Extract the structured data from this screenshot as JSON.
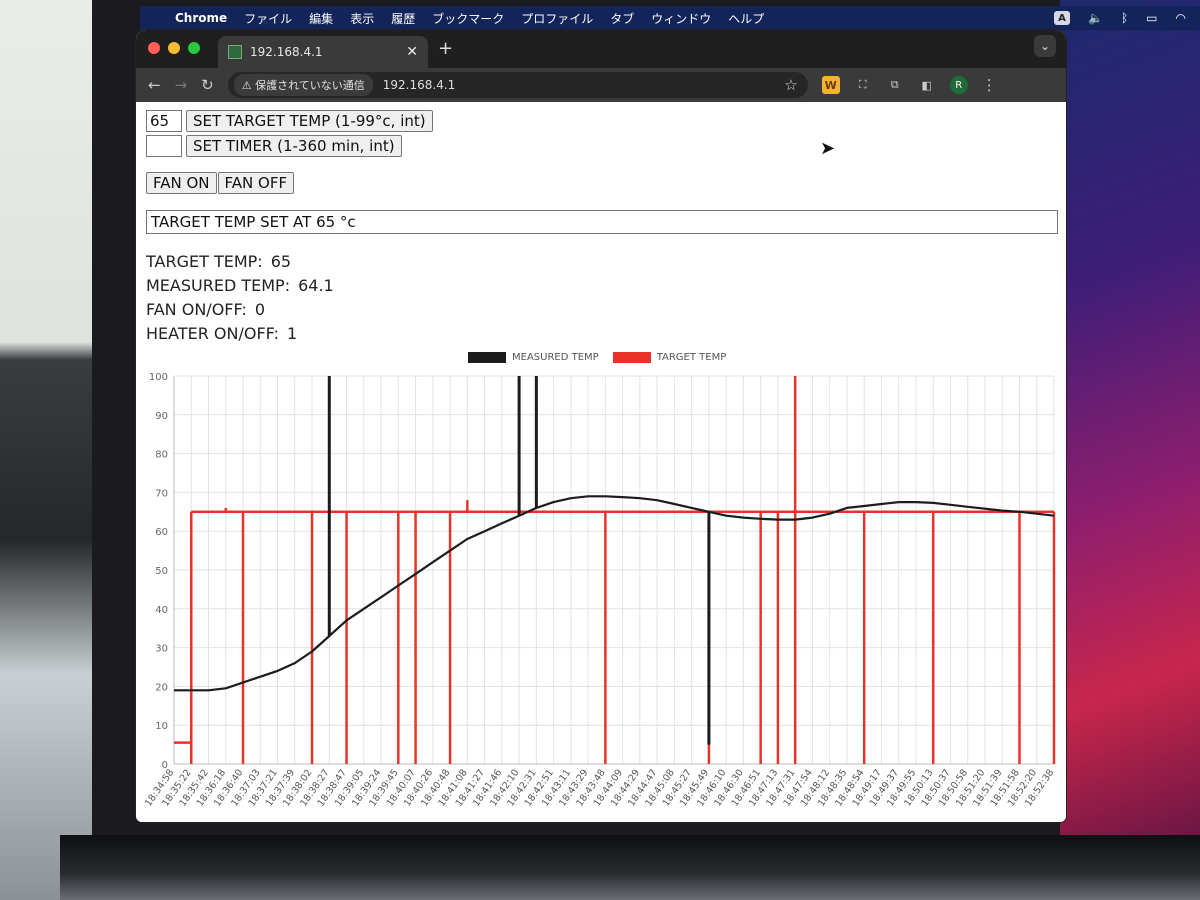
{
  "menubar": {
    "app_name": "Chrome",
    "items": [
      "ファイル",
      "編集",
      "表示",
      "履歴",
      "ブックマーク",
      "プロファイル",
      "タブ",
      "ウィンドウ",
      "ヘルプ"
    ],
    "input_indicator": "A"
  },
  "browser": {
    "tab_title": "192.168.4.1",
    "security_label": "保護されていない通信",
    "url": "192.168.4.1",
    "profile_initial": "R"
  },
  "controls": {
    "target_temp_value": "65",
    "set_target_label": "SET TARGET TEMP (1-99°c, int)",
    "timer_value": "",
    "set_timer_label": "SET TIMER (1-360 min, int)",
    "fan_on_label": "FAN ON",
    "fan_off_label": "FAN OFF",
    "message": "TARGET TEMP SET AT 65 °c"
  },
  "status": {
    "target_label": "TARGET TEMP:",
    "target_value": "65",
    "measured_label": "MEASURED TEMP:",
    "measured_value": "64.1",
    "fan_label": "FAN ON/OFF:",
    "fan_value": "0",
    "heater_label": "HEATER ON/OFF:",
    "heater_value": "1"
  },
  "chart_data": {
    "type": "line",
    "title": "",
    "xlabel": "",
    "ylabel": "",
    "ylim": [
      0,
      100
    ],
    "yticks": [
      0,
      10,
      20,
      30,
      40,
      50,
      60,
      70,
      80,
      90,
      100
    ],
    "grid": true,
    "legend_position": "top-center",
    "x_tick_labels": [
      "18:34:58",
      "18:35:22",
      "18:35:42",
      "18:36:18",
      "18:36:40",
      "18:37:03",
      "18:37:21",
      "18:37:39",
      "18:38:02",
      "18:38:27",
      "18:38:47",
      "18:39:05",
      "18:39:24",
      "18:39:45",
      "18:40:07",
      "18:40:26",
      "18:40:48",
      "18:41:08",
      "18:41:27",
      "18:41:46",
      "18:42:10",
      "18:42:31",
      "18:42:51",
      "18:43:11",
      "18:43:29",
      "18:43:48",
      "18:44:09",
      "18:44:29",
      "18:44:47",
      "18:45:08",
      "18:45:27",
      "18:45:49",
      "18:46:10",
      "18:46:30",
      "18:46:51",
      "18:47:13",
      "18:47:31",
      "18:47:54",
      "18:48:12",
      "18:48:35",
      "18:48:54",
      "18:49:17",
      "18:49:37",
      "18:49:55",
      "18:50:13",
      "18:50:37",
      "18:50:58",
      "18:51:20",
      "18:51:39",
      "18:51:58",
      "18:52:20",
      "18:52:38"
    ],
    "series": [
      {
        "name": "MEASURED TEMP",
        "color": "#1c1c1c",
        "points": [
          [
            "18:34:58",
            19
          ],
          [
            "18:35:42",
            19
          ],
          [
            "18:36:18",
            19.5
          ],
          [
            "18:36:40",
            21
          ],
          [
            "18:37:21",
            24
          ],
          [
            "18:37:39",
            26
          ],
          [
            "18:38:02",
            29
          ],
          [
            "18:38:27",
            33
          ],
          [
            "18:38:47",
            37
          ],
          [
            "18:39:05",
            40
          ],
          [
            "18:39:24",
            43
          ],
          [
            "18:39:45",
            46
          ],
          [
            "18:40:07",
            49
          ],
          [
            "18:40:26",
            52
          ],
          [
            "18:40:48",
            55
          ],
          [
            "18:41:08",
            58
          ],
          [
            "18:41:27",
            60
          ],
          [
            "18:41:46",
            62
          ],
          [
            "18:42:10",
            64
          ],
          [
            "18:42:31",
            66
          ],
          [
            "18:42:51",
            67.5
          ],
          [
            "18:43:11",
            68.5
          ],
          [
            "18:43:29",
            69
          ],
          [
            "18:43:48",
            69
          ],
          [
            "18:44:09",
            68.8
          ],
          [
            "18:44:29",
            68.5
          ],
          [
            "18:44:47",
            68
          ],
          [
            "18:45:08",
            67
          ],
          [
            "18:45:27",
            66
          ],
          [
            "18:45:49",
            65
          ],
          [
            "18:46:10",
            64
          ],
          [
            "18:46:30",
            63.5
          ],
          [
            "18:46:51",
            63.2
          ],
          [
            "18:47:13",
            63
          ],
          [
            "18:47:31",
            63
          ],
          [
            "18:47:54",
            63.5
          ],
          [
            "18:48:12",
            64.5
          ],
          [
            "18:48:35",
            66
          ],
          [
            "18:48:54",
            66.5
          ],
          [
            "18:49:17",
            67
          ],
          [
            "18:49:37",
            67.5
          ],
          [
            "18:49:55",
            67.5
          ],
          [
            "18:50:13",
            67.3
          ],
          [
            "18:50:37",
            66.8
          ],
          [
            "18:50:58",
            66.3
          ],
          [
            "18:51:20",
            65.8
          ],
          [
            "18:51:39",
            65.3
          ],
          [
            "18:51:58",
            65
          ],
          [
            "18:52:20",
            64.5
          ],
          [
            "18:52:38",
            64
          ]
        ],
        "spikes": [
          [
            "18:38:27",
            100
          ],
          [
            "18:42:10",
            100
          ],
          [
            "18:42:31",
            100
          ],
          [
            "18:45:49",
            5
          ]
        ]
      },
      {
        "name": "TARGET TEMP",
        "color": "#e8332a",
        "level_changes": [
          [
            "18:34:58",
            5.5
          ],
          [
            "18:35:22",
            65
          ]
        ],
        "drops_to_zero": [
          "18:35:22",
          "18:36:40",
          "18:38:02",
          "18:38:47",
          "18:39:45",
          "18:40:07",
          "18:40:48",
          "18:43:48",
          "18:45:49",
          "18:46:51",
          "18:47:13",
          "18:47:31",
          "18:48:54",
          "18:50:13",
          "18:51:58",
          "18:52:38"
        ],
        "spikes": [
          [
            "18:47:31",
            100
          ],
          [
            "18:41:08",
            68
          ],
          [
            "18:36:18",
            66
          ]
        ]
      }
    ]
  }
}
